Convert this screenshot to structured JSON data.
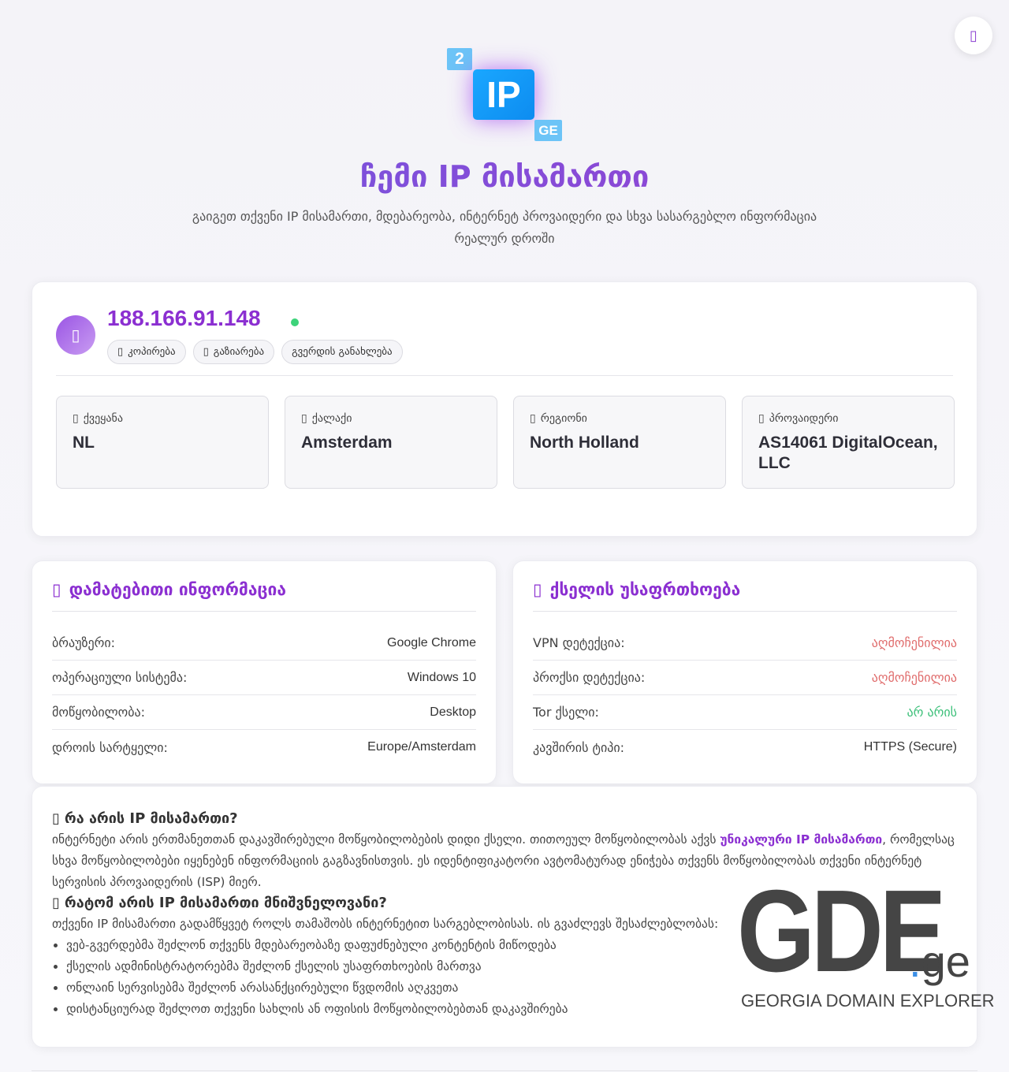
{
  "theme_toggle": {
    "icon": "moon-icon",
    "glyph": "▯"
  },
  "logo": {
    "top_badge": "2",
    "main": "IP",
    "bottom_badge": "GE"
  },
  "header": {
    "title": "ჩემი IP მისამართი",
    "subtitle": "გაიგეთ თქვენი IP მისამართი, მდებარეობა, ინტერნეტ პროვაიდერი და სხვა სასარგებლო ინფორმაცია რეალურ დროში"
  },
  "ip_card": {
    "avatar_glyph": "▯",
    "ip": "188.166.91.148",
    "actions": {
      "copy": "კოპირება",
      "share": "გაზიარება",
      "refresh": "გვერდის განახლება",
      "copy_glyph": "▯",
      "share_glyph": "▯"
    },
    "stats": [
      {
        "label": "ქვეყანა",
        "value": "NL",
        "glyph": "▯"
      },
      {
        "label": "ქალაქი",
        "value": "Amsterdam",
        "glyph": "▯"
      },
      {
        "label": "რეგიონი",
        "value": "North Holland",
        "glyph": "▯"
      },
      {
        "label": "პროვაიდერი",
        "value": "AS14061 DigitalOcean, LLC",
        "glyph": "▯"
      }
    ]
  },
  "extra_info": {
    "title_glyph": "▯",
    "title": "დამატებითი ინფორმაცია",
    "rows": [
      {
        "key": "ბრაუზერი:",
        "value": "Google Chrome"
      },
      {
        "key": "ოპერაციული სისტემა:",
        "value": "Windows 10"
      },
      {
        "key": "მოწყობილობა:",
        "value": "Desktop"
      },
      {
        "key": "დროის სარტყელი:",
        "value": "Europe/Amsterdam"
      }
    ]
  },
  "security": {
    "title_glyph": "▯",
    "title": "ქსელის უსაფრთხოება",
    "rows": [
      {
        "key": "VPN დეტექცია:",
        "value": "აღმოჩენილია"
      },
      {
        "key": "პროქსი დეტექცია:",
        "value": "აღმოჩენილია"
      },
      {
        "key": "Tor ქსელი:",
        "value": "არ არის"
      },
      {
        "key": "კავშირის ტიპი:",
        "value": "HTTPS (Secure)"
      }
    ]
  },
  "about": {
    "h1_glyph": "▯",
    "h1": "რა არის IP მისამართი?",
    "p1_a": "ინტერნეტი არის ერთმანეთთან დაკავშირებული მოწყობილობების დიდი ქსელი. თითოეულ მოწყობილობას აქვს ",
    "p1_hl": "უნიკალური IP მისამართი",
    "p1_b": ", რომელსაც სხვა მოწყობილობები იყენებენ ინფორმაციის გაგზავნისთვის. ეს იდენტიფიკატორი ავტომატურად ენიჭება თქვენს მოწყობილობას თქვენი ინტერნეტ სერვისის პროვაიდერის (ISP) მიერ.",
    "h2_glyph": "▯",
    "h2": "რატომ არის IP მისამართი მნიშვნელოვანი?",
    "p2": "თქვენი IP მისამართი გადამწყვეტ როლს თამაშობს ინტერნეტით სარგებლობისას. ის გვაძლევს შესაძლებლობას:",
    "list": [
      "ვებ-გვერდებმა შეძლონ თქვენს მდებარეობაზე დაფუძნებული კონტენტის მიწოდება",
      "ქსელის ადმინისტრატორებმა შეძლონ ქსელის უსაფრთხოების მართვა",
      "ონლაინ სერვისებმა შეძლონ არასანქცირებული წვდომის აღკვეთა",
      "დისტანციურად შეძლოთ თქვენი სახლის ან ოფისის მოწყობილობებთან დაკავშირება"
    ]
  },
  "watermark": {
    "letters": "GDE",
    "dot": ".",
    "tld": "ge",
    "tagline": "GEORGIA DOMAIN EXPLORER"
  },
  "colors": {
    "accent": "#8b2fd1",
    "online": "#3dd37a",
    "detected": "#e06c6c",
    "ok": "#3dc07a"
  }
}
